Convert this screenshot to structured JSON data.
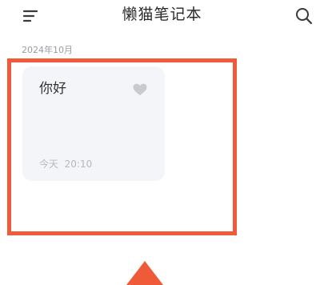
{
  "header": {
    "title": "懒猫笔记本",
    "menu_icon": "menu-icon",
    "search_icon": "search-icon"
  },
  "notes_section": {
    "date_group": "2024年10月",
    "notes": [
      {
        "title": "你好",
        "time": "今天  20:10",
        "favorite_icon": "heart-icon"
      }
    ]
  },
  "annotation": {
    "highlight_color": "#ef5b38",
    "arrow_color": "#ef5b38"
  }
}
